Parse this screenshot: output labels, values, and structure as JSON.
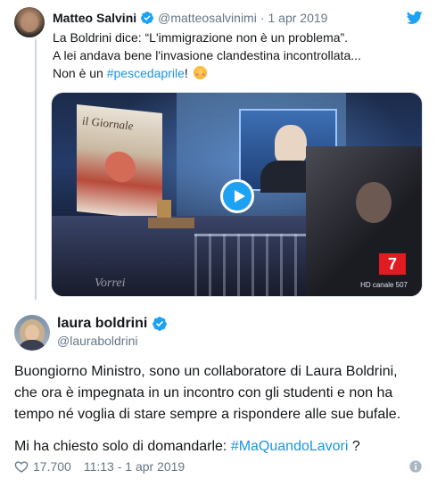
{
  "tweet_quoted": {
    "author_name": "Matteo Salvini",
    "handle": "@matteosalvinimi",
    "separator": "·",
    "date": "1 apr 2019",
    "text_line1": "La Boldrini dice: “L'immigrazione non è un problema”.",
    "text_line2": "A lei andava bene l'invasione clandestina incontrollata...",
    "text_line3_prefix": "Non è un ",
    "hashtag": "#pescedaprile",
    "text_line3_suffix": "!",
    "emoji": "blushing-face-emoji",
    "video": {
      "overlay_title": "il Giornale",
      "watermark": "Vorrei",
      "channel_logo": "7",
      "channel_caption": "HD canale 507"
    }
  },
  "tweet_reply": {
    "author_name": "laura boldrini",
    "handle": "@lauraboldrini",
    "text_line1": "Buongiorno Ministro, sono un collaboratore di Laura Boldrini,",
    "text_line2": "che ora è impegnata in un incontro con gli studenti e non ha",
    "text_line3": "tempo né voglia di stare sempre a rispondere alle sue bufale.",
    "text_line4_prefix": "Mi ha chiesto solo di domandarle: ",
    "hashtag": "#MaQuandoLavori",
    "text_line4_suffix": " ?",
    "likes": "17.700",
    "timestamp": "11:13 - 1 apr 2019"
  },
  "colors": {
    "twitter_blue": "#1da1f2",
    "hashtag_blue": "#1b95e0",
    "muted_text": "#657786",
    "thread_line": "#ccd6dd"
  }
}
